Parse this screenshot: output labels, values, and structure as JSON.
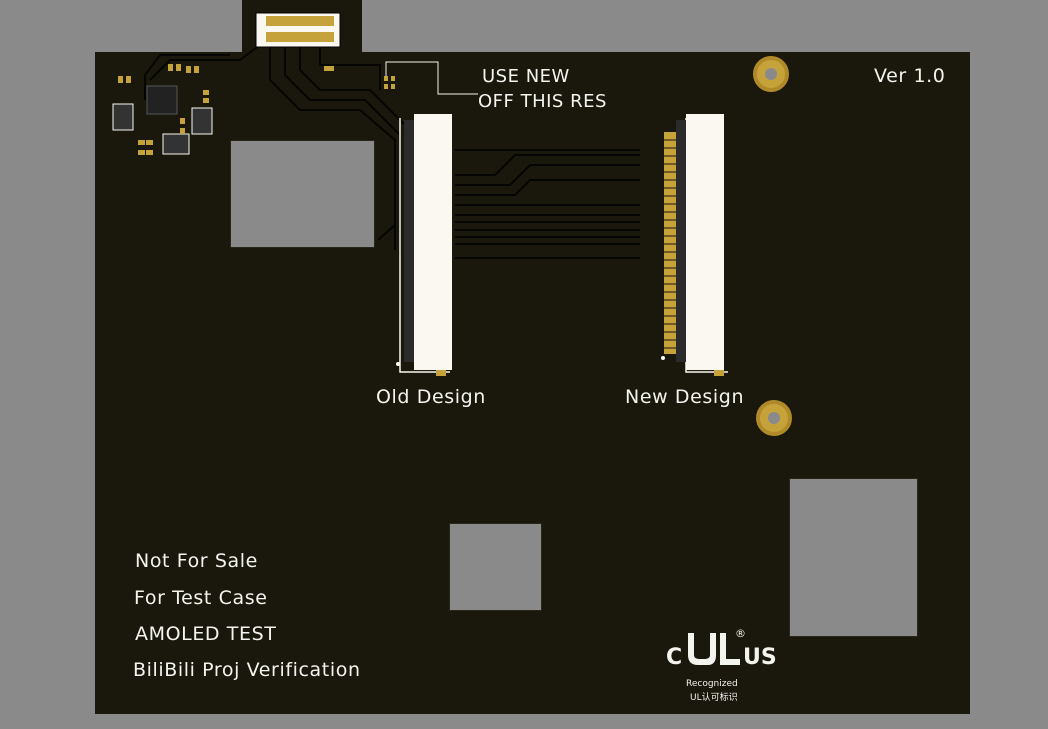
{
  "board": {
    "version": "Ver 1.0",
    "note": [
      "USE NEW",
      "OFF THIS RES"
    ],
    "connector_labels": [
      "Old Design",
      "New Design"
    ],
    "text_lines": [
      "Not For Sale",
      "For Test Case",
      "AMOLED TEST",
      "BiliBili Proj Verification"
    ],
    "ul_mark": {
      "c": "C",
      "us": "US",
      "reg": "®",
      "recognized": "Recognized",
      "cn": "UL认可标识"
    }
  },
  "colors": {
    "pcb": "#1a170c",
    "silkscreen": "#f4f4ef",
    "copper": "#c5a23a",
    "background": "#8a8a8a"
  }
}
